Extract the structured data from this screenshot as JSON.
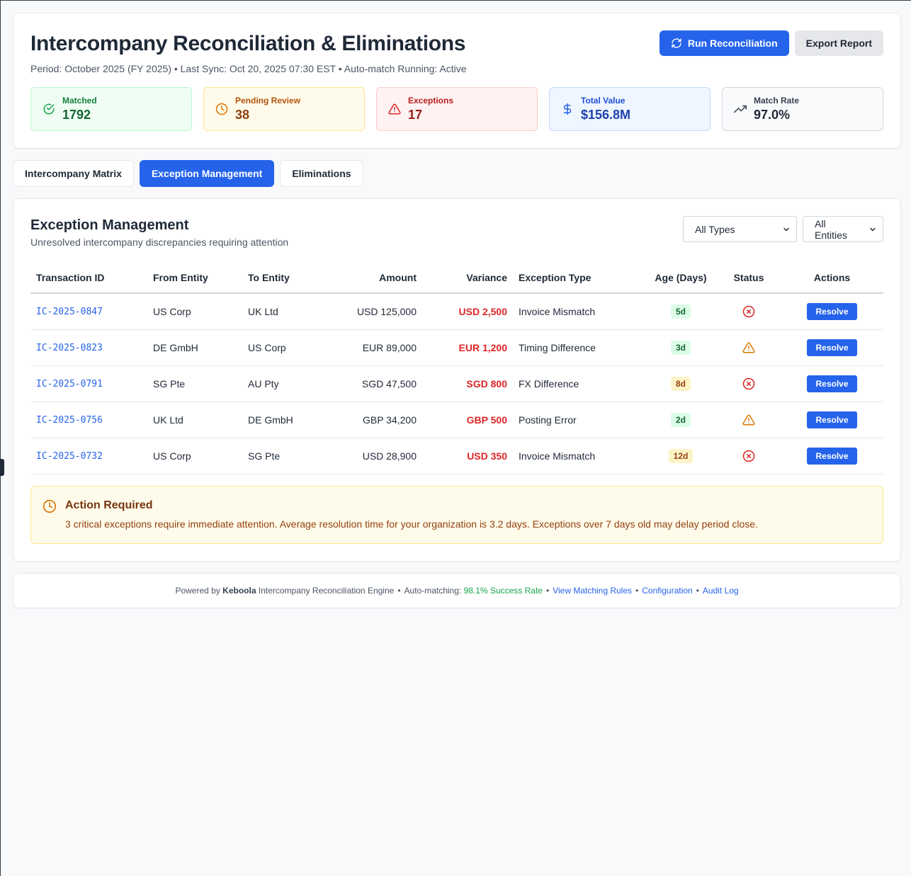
{
  "header": {
    "title": "Intercompany Reconciliation & Eliminations",
    "subtitle": "Period: October 2025 (FY 2025) • Last Sync: Oct 20, 2025 07:30 EST • Auto-match Running: Active",
    "run_label": "Run Reconciliation",
    "export_label": "Export Report"
  },
  "stats": [
    {
      "label": "Matched",
      "value": "1792",
      "icon": "check-circle-icon"
    },
    {
      "label": "Pending Review",
      "value": "38",
      "icon": "clock-icon"
    },
    {
      "label": "Exceptions",
      "value": "17",
      "icon": "warning-icon"
    },
    {
      "label": "Total Value",
      "value": "$156.8M",
      "icon": "dollar-icon"
    },
    {
      "label": "Match Rate",
      "value": "97.0%",
      "icon": "trending-up-icon"
    }
  ],
  "tabs": [
    {
      "label": "Intercompany Matrix",
      "active": false
    },
    {
      "label": "Exception Management",
      "active": true
    },
    {
      "label": "Eliminations",
      "active": false
    }
  ],
  "panel": {
    "title": "Exception Management",
    "subtitle": "Unresolved intercompany discrepancies requiring attention",
    "filter_type": "All Types",
    "filter_entity": "All Entities"
  },
  "table": {
    "headers": [
      "Transaction ID",
      "From Entity",
      "To Entity",
      "Amount",
      "Variance",
      "Exception Type",
      "Age (Days)",
      "Status",
      "Actions"
    ],
    "rows": [
      {
        "id": "IC-2025-0847",
        "from": "US Corp",
        "to": "UK Ltd",
        "amount": "USD 125,000",
        "variance": "USD 2,500",
        "type": "Invoice Mismatch",
        "age": "5d",
        "age_level": "green",
        "status": "error",
        "action": "Resolve"
      },
      {
        "id": "IC-2025-0823",
        "from": "DE GmbH",
        "to": "US Corp",
        "amount": "EUR 89,000",
        "variance": "EUR 1,200",
        "type": "Timing Difference",
        "age": "3d",
        "age_level": "green",
        "status": "warning",
        "action": "Resolve"
      },
      {
        "id": "IC-2025-0791",
        "from": "SG Pte",
        "to": "AU Pty",
        "amount": "SGD 47,500",
        "variance": "SGD 800",
        "type": "FX Difference",
        "age": "8d",
        "age_level": "yellow",
        "status": "error",
        "action": "Resolve"
      },
      {
        "id": "IC-2025-0756",
        "from": "UK Ltd",
        "to": "DE GmbH",
        "amount": "GBP 34,200",
        "variance": "GBP 500",
        "type": "Posting Error",
        "age": "2d",
        "age_level": "green",
        "status": "warning",
        "action": "Resolve"
      },
      {
        "id": "IC-2025-0732",
        "from": "US Corp",
        "to": "SG Pte",
        "amount": "USD 28,900",
        "variance": "USD 350",
        "type": "Invoice Mismatch",
        "age": "12d",
        "age_level": "yellow",
        "status": "error",
        "action": "Resolve"
      }
    ]
  },
  "alert": {
    "title": "Action Required",
    "text": "3 critical exceptions require immediate attention. Average resolution time for your organization is 3.2 days. Exceptions over 7 days old may delay period close."
  },
  "footer": {
    "powered_prefix": "Powered by",
    "brand": "Keboola",
    "engine": "Intercompany Reconciliation Engine",
    "auto_label": "Auto-matching:",
    "success_rate": "98.1% Success Rate",
    "links": [
      "View Matching Rules",
      "Configuration",
      "Audit Log"
    ]
  },
  "colors": {
    "accent": "#2563eb",
    "error": "#dc2626",
    "warning": "#d97706"
  }
}
